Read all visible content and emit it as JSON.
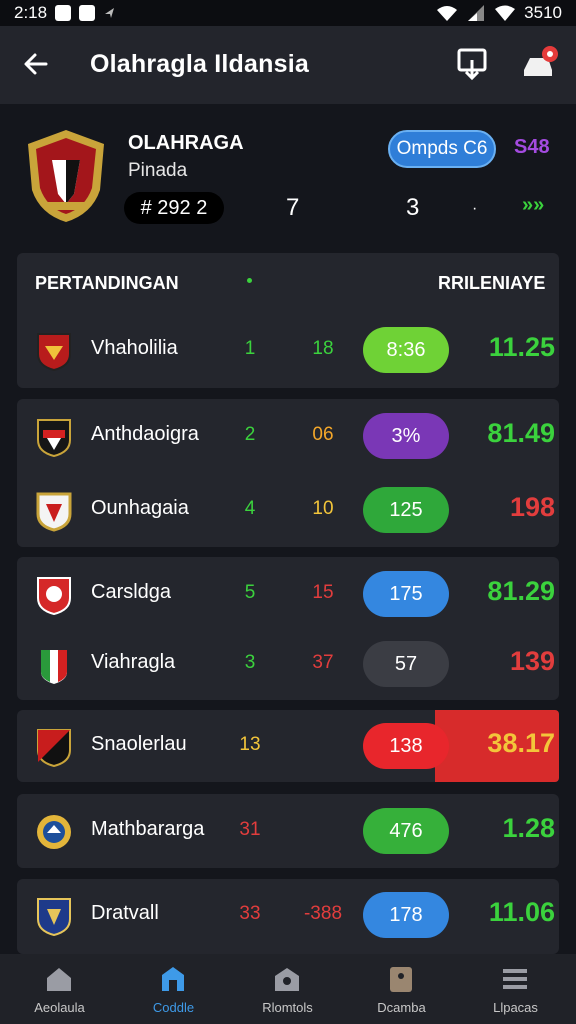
{
  "status_bar": {
    "time": "2:18",
    "battery": "3510"
  },
  "app_bar": {
    "title": "Olahragla Ildansia"
  },
  "team": {
    "name": "OLAHRAGA",
    "subtitle": "Pinada",
    "code": "# 292 2",
    "stat_a": "7",
    "stat_b": "3",
    "stat_c": "·",
    "trend": "»»",
    "action_pill": "Ompds C6",
    "score_purple": "S48"
  },
  "table": {
    "col_left": "PERTANDINGAN",
    "col_right": "RRILENIAYE",
    "rows": [
      {
        "name": "Vhaholilia",
        "n1": "1",
        "n2": "18",
        "pill": "8:36",
        "value": "11.25"
      },
      {
        "name": "Anthdaoigra",
        "n1": "2",
        "n2": "06",
        "pill": "3%",
        "value": "81.49"
      },
      {
        "name": "Ounhagaia",
        "n1": "4",
        "n2": "10",
        "pill": "125",
        "value": "198"
      },
      {
        "name": "Carsldga",
        "n1": "5",
        "n2": "15",
        "pill": "175",
        "value": "81.29"
      },
      {
        "name": "Viahragla",
        "n1": "3",
        "n2": "37",
        "pill": "57",
        "value": "139"
      },
      {
        "name": "Snaolerlau",
        "n1": "13",
        "n2": "",
        "pill": "138",
        "value": "38.17"
      },
      {
        "name": "Mathbararga",
        "n1": "31",
        "n2": "",
        "pill": "476",
        "value": "1.28"
      },
      {
        "name": "Dratvall",
        "n1": "33",
        "n2": "-388",
        "pill": "178",
        "value": "11.06"
      }
    ]
  },
  "nav": [
    {
      "label": "Aeolaula",
      "icon": "home-icon"
    },
    {
      "label": "Coddle",
      "icon": "stadium-icon"
    },
    {
      "label": "Rlomtols",
      "icon": "team-icon"
    },
    {
      "label": "Dcamba",
      "icon": "ticket-icon"
    },
    {
      "label": "Llpacas",
      "icon": "menu-icon"
    }
  ]
}
